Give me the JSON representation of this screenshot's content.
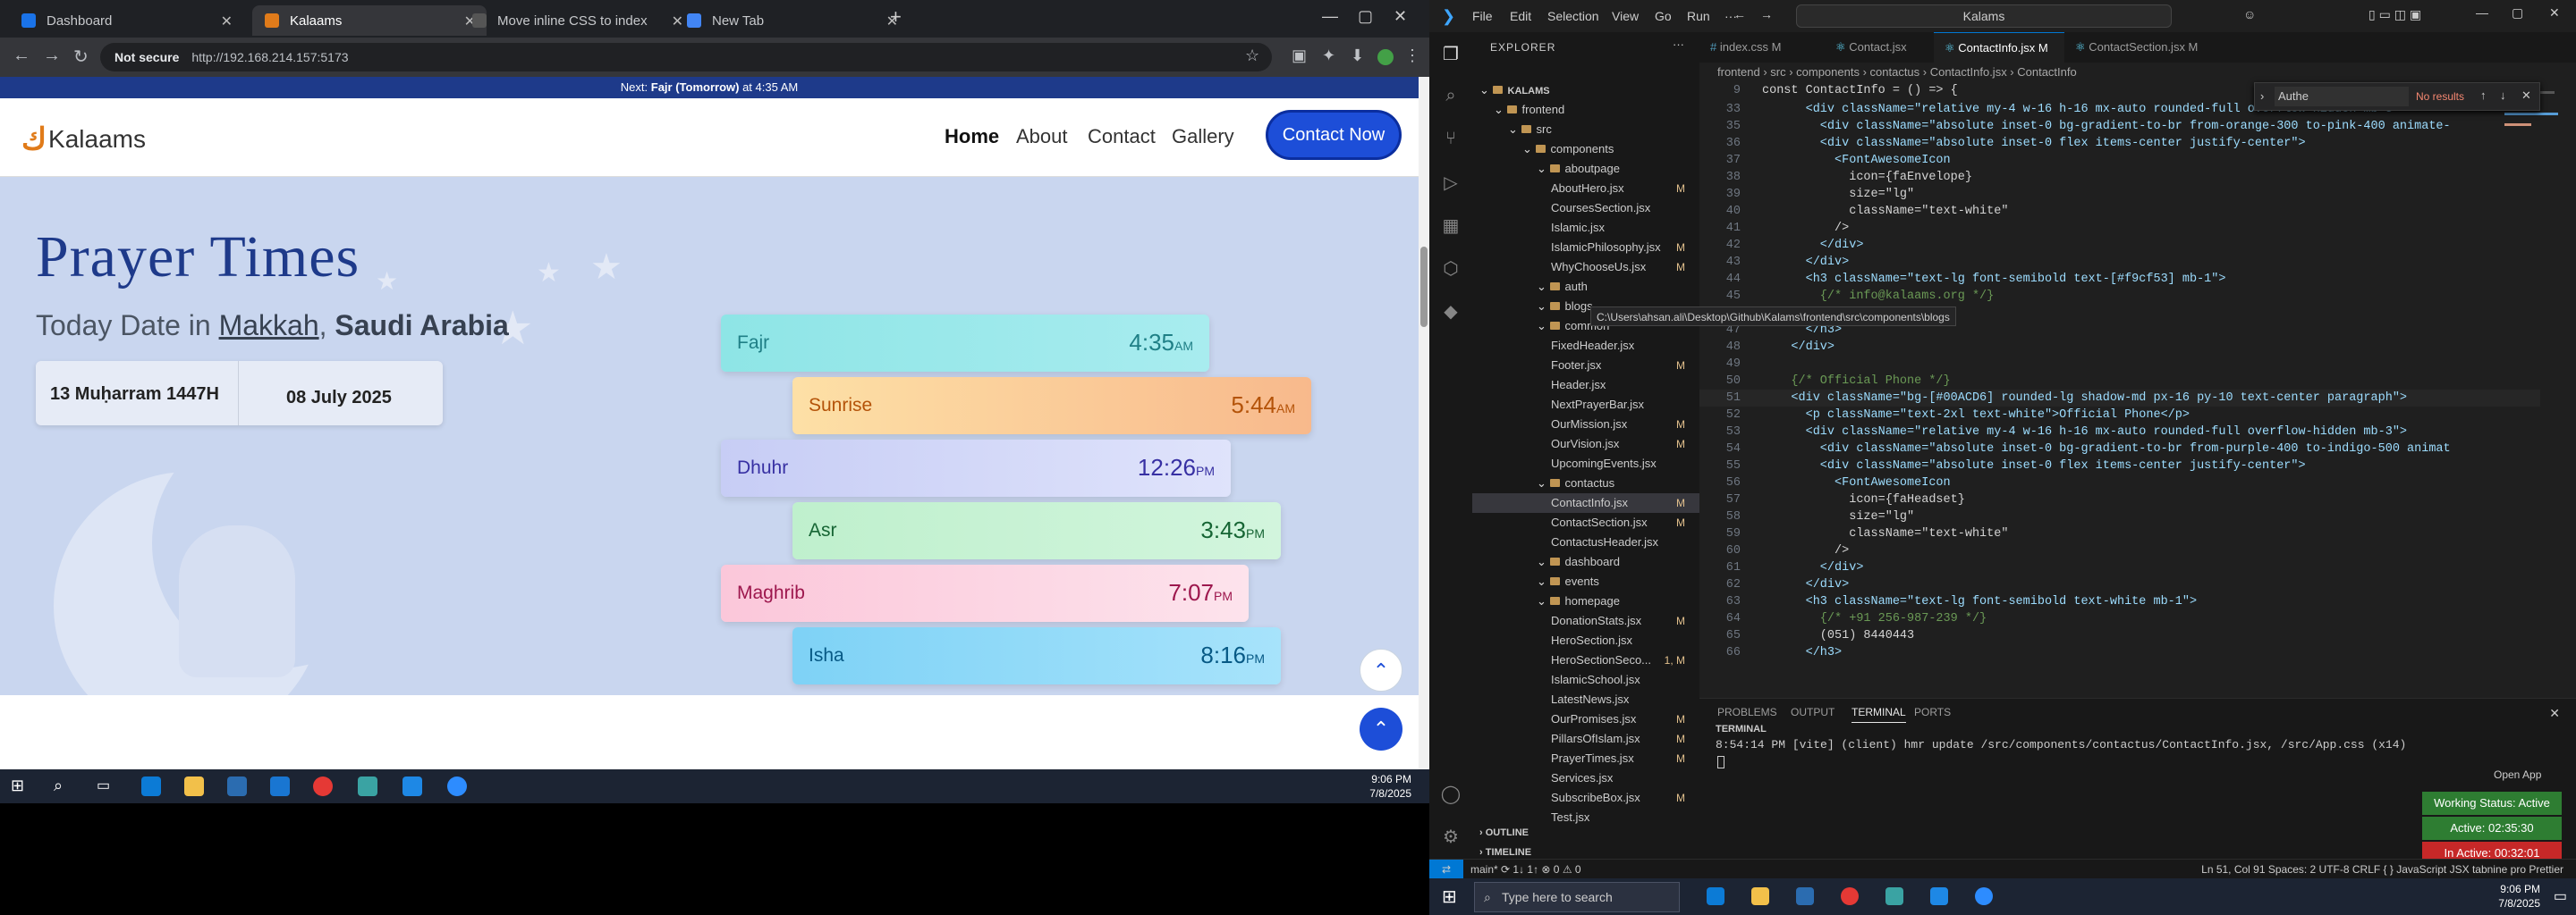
{
  "browser": {
    "tabs": [
      {
        "title": "Dashboard",
        "active": false,
        "color": "#1a73e8"
      },
      {
        "title": "Kalaams",
        "active": true,
        "color": "#e07b1a"
      },
      {
        "title": "Move inline CSS to index",
        "active": false,
        "color": "#555"
      },
      {
        "title": "New Tab",
        "active": false,
        "color": "#4285f4"
      }
    ],
    "not_secure": "Not secure",
    "url": "http://192.168.214.157:5173"
  },
  "site": {
    "notice_prefix": "Next: ",
    "notice_name": "Fajr (Tomorrow)",
    "notice_suffix": " at 4:35 AM",
    "logo_mark": "ك",
    "logo_text": "Kalaams",
    "nav": [
      "Home",
      "About",
      "Contact",
      "Gallery"
    ],
    "cta": "Contact Now",
    "title": "Prayer Times",
    "date_prefix": "Today Date in ",
    "city": "Makkah",
    "country": "Saudi Arabia",
    "hijri": "13 Muḥarram 1447H",
    "greg": "08 July 2025",
    "prayers": [
      {
        "name": "Fajr",
        "time": "4:35",
        "ampm": "AM",
        "bg": "linear-gradient(90deg,#8ee5e6,#a8ecef)",
        "fg": "#1f7f86"
      },
      {
        "name": "Sunrise",
        "time": "5:44",
        "ampm": "AM",
        "bg": "linear-gradient(90deg,#fde0a6,#f8b98c)",
        "fg": "#b45309"
      },
      {
        "name": "Dhuhr",
        "time": "12:26",
        "ampm": "PM",
        "bg": "linear-gradient(90deg,#c7cdf5,#dfe3fb)",
        "fg": "#3730a3"
      },
      {
        "name": "Asr",
        "time": "3:43",
        "ampm": "PM",
        "bg": "linear-gradient(90deg,#bff0cd,#d2f5dd)",
        "fg": "#166534"
      },
      {
        "name": "Maghrib",
        "time": "7:07",
        "ampm": "PM",
        "bg": "linear-gradient(90deg,#fbc7da,#fde3ec)",
        "fg": "#9d174d"
      },
      {
        "name": "Isha",
        "time": "8:16",
        "ampm": "PM",
        "bg": "linear-gradient(90deg,#7ed2f6,#a7e3fb)",
        "fg": "#075985"
      }
    ]
  },
  "taskbar_left": {
    "time": "9:06 PM",
    "date": "7/8/2025"
  },
  "vscode": {
    "menu": [
      "File",
      "Edit",
      "Selection",
      "View",
      "Go",
      "Run",
      "···"
    ],
    "search": "Kalams",
    "explorer_title": "EXPLORER",
    "tree": [
      {
        "label": "KALAMS",
        "indent": 0,
        "type": "root",
        "status": ""
      },
      {
        "label": "frontend",
        "indent": 1,
        "type": "folder",
        "status": ""
      },
      {
        "label": "src",
        "indent": 2,
        "type": "folder",
        "status": ""
      },
      {
        "label": "components",
        "indent": 3,
        "type": "folder",
        "status": ""
      },
      {
        "label": "aboutpage",
        "indent": 4,
        "type": "folder",
        "status": ""
      },
      {
        "label": "AboutHero.jsx",
        "indent": 5,
        "type": "file",
        "status": "M"
      },
      {
        "label": "CoursesSection.jsx",
        "indent": 5,
        "type": "file",
        "status": ""
      },
      {
        "label": "Islamic.jsx",
        "indent": 5,
        "type": "file",
        "status": ""
      },
      {
        "label": "IslamicPhilosophy.jsx",
        "indent": 5,
        "type": "file",
        "status": "M"
      },
      {
        "label": "WhyChooseUs.jsx",
        "indent": 5,
        "type": "file",
        "status": "M"
      },
      {
        "label": "auth",
        "indent": 4,
        "type": "folder",
        "status": ""
      },
      {
        "label": "blogs",
        "indent": 4,
        "type": "folder",
        "status": ""
      },
      {
        "label": "common",
        "indent": 4,
        "type": "folder",
        "status": ""
      },
      {
        "label": "FixedHeader.jsx",
        "indent": 5,
        "type": "file",
        "status": ""
      },
      {
        "label": "Footer.jsx",
        "indent": 5,
        "type": "file",
        "status": "M"
      },
      {
        "label": "Header.jsx",
        "indent": 5,
        "type": "file",
        "status": ""
      },
      {
        "label": "NextPrayerBar.jsx",
        "indent": 5,
        "type": "file",
        "status": ""
      },
      {
        "label": "OurMission.jsx",
        "indent": 5,
        "type": "file",
        "status": "M"
      },
      {
        "label": "OurVision.jsx",
        "indent": 5,
        "type": "file",
        "status": "M"
      },
      {
        "label": "UpcomingEvents.jsx",
        "indent": 5,
        "type": "file",
        "status": ""
      },
      {
        "label": "contactus",
        "indent": 4,
        "type": "folder",
        "status": ""
      },
      {
        "label": "ContactInfo.jsx",
        "indent": 5,
        "type": "file",
        "status": "M",
        "sel": true
      },
      {
        "label": "ContactSection.jsx",
        "indent": 5,
        "type": "file",
        "status": "M"
      },
      {
        "label": "ContactusHeader.jsx",
        "indent": 5,
        "type": "file",
        "status": ""
      },
      {
        "label": "dashboard",
        "indent": 4,
        "type": "folder",
        "status": ""
      },
      {
        "label": "events",
        "indent": 4,
        "type": "folder",
        "status": ""
      },
      {
        "label": "homepage",
        "indent": 4,
        "type": "folder",
        "status": ""
      },
      {
        "label": "DonationStats.jsx",
        "indent": 5,
        "type": "file",
        "status": "M"
      },
      {
        "label": "HeroSection.jsx",
        "indent": 5,
        "type": "file",
        "status": ""
      },
      {
        "label": "HeroSectionSeco...",
        "indent": 5,
        "type": "file",
        "status": "1, M"
      },
      {
        "label": "IslamicSchool.jsx",
        "indent": 5,
        "type": "file",
        "status": ""
      },
      {
        "label": "LatestNews.jsx",
        "indent": 5,
        "type": "file",
        "status": ""
      },
      {
        "label": "OurPromises.jsx",
        "indent": 5,
        "type": "file",
        "status": "M"
      },
      {
        "label": "PillarsOfIslam.jsx",
        "indent": 5,
        "type": "file",
        "status": "M"
      },
      {
        "label": "PrayerTimes.jsx",
        "indent": 5,
        "type": "file",
        "status": "M"
      },
      {
        "label": "Services.jsx",
        "indent": 5,
        "type": "file",
        "status": ""
      },
      {
        "label": "SubscribeBox.jsx",
        "indent": 5,
        "type": "file",
        "status": "M"
      },
      {
        "label": "Test.jsx",
        "indent": 5,
        "type": "file",
        "status": ""
      }
    ],
    "tooltip": "C:\\Users\\ahsan.ali\\Desktop\\Github\\Kalams\\frontend\\src\\components\\blogs",
    "outline": "OUTLINE",
    "timeline": "TIMELINE",
    "tabs": [
      "index.css M",
      "Contact.jsx",
      "ContactInfo.jsx M",
      "ContactSection.jsx M"
    ],
    "breadcrumb": "frontend › src › components › contactus › ContactInfo.jsx › ContactInfo",
    "find": {
      "value": "Authe",
      "result": "No results"
    },
    "code": [
      {
        "n": "9",
        "t": "const ContactInfo = () => {"
      },
      {
        "n": "33",
        "t": "      <div className=\"relative my-4 w-16 h-16 mx-auto rounded-full overflow-hidden mb-3\">"
      },
      {
        "n": "35",
        "t": "        <div className=\"absolute inset-0 bg-gradient-to-br from-orange-300 to-pink-400 animate-"
      },
      {
        "n": "36",
        "t": "        <div className=\"absolute inset-0 flex items-center justify-center\">"
      },
      {
        "n": "37",
        "t": "          <FontAwesomeIcon"
      },
      {
        "n": "38",
        "t": "            icon={faEnvelope}"
      },
      {
        "n": "39",
        "t": "            size=\"lg\""
      },
      {
        "n": "40",
        "t": "            className=\"text-white\""
      },
      {
        "n": "41",
        "t": "          />"
      },
      {
        "n": "42",
        "t": "        </div>"
      },
      {
        "n": "43",
        "t": "      </div>"
      },
      {
        "n": "44",
        "t": "      <h3 className=\"text-lg font-semibold text-[#f9cf53] mb-1\">"
      },
      {
        "n": "45",
        "t": "        {/* info@kalaams.org */}"
      },
      {
        "n": "46",
        "t": "        info@kalaams.org"
      },
      {
        "n": "47",
        "t": "      </h3>"
      },
      {
        "n": "48",
        "t": "    </div>"
      },
      {
        "n": "49",
        "t": ""
      },
      {
        "n": "50",
        "t": "    {/* Official Phone */}"
      },
      {
        "n": "51",
        "t": "    <div className=\"bg-[#00ACD6] rounded-lg shadow-md px-16 py-10 text-center paragraph\">"
      },
      {
        "n": "52",
        "t": "      <p className=\"text-2xl text-white\">Official Phone</p>"
      },
      {
        "n": "53",
        "t": "      <div className=\"relative my-4 w-16 h-16 mx-auto rounded-full overflow-hidden mb-3\">"
      },
      {
        "n": "54",
        "t": "        <div className=\"absolute inset-0 bg-gradient-to-br from-purple-400 to-indigo-500 animat"
      },
      {
        "n": "55",
        "t": "        <div className=\"absolute inset-0 flex items-center justify-center\">"
      },
      {
        "n": "56",
        "t": "          <FontAwesomeIcon"
      },
      {
        "n": "57",
        "t": "            icon={faHeadset}"
      },
      {
        "n": "58",
        "t": "            size=\"lg\""
      },
      {
        "n": "59",
        "t": "            className=\"text-white\""
      },
      {
        "n": "60",
        "t": "          />"
      },
      {
        "n": "61",
        "t": "        </div>"
      },
      {
        "n": "62",
        "t": "      </div>"
      },
      {
        "n": "63",
        "t": "      <h3 className=\"text-lg font-semibold text-white mb-1\">"
      },
      {
        "n": "64",
        "t": "        {/* +91 256-987-239 */}"
      },
      {
        "n": "65",
        "t": "        (051) 8440443"
      },
      {
        "n": "66",
        "t": "      </h3>"
      }
    ],
    "panel_tabs": [
      "PROBLEMS",
      "OUTPUT",
      "TERMINAL",
      "PORTS"
    ],
    "terminal_title": "TERMINAL",
    "terminal_line": "8:54:14 PM [vite] (client) hmr update /src/components/contactus/ContactInfo.jsx, /src/App.css (x14)",
    "open_app": "Open App",
    "working": "Working Status: Active",
    "active": "Active: 02:35:30",
    "inactive": "In Active: 00:32:01",
    "status_left": "main*  ⟳ 1↓ 1↑   ⊗ 0 ⚠ 0",
    "status_right": "Ln 51, Col 91   Spaces: 2   UTF-8   CRLF   { } JavaScript JSX   tabnine pro   Prettier",
    "search_placeholder": "Type here to search",
    "time": "9:06 PM",
    "date": "7/8/2025"
  }
}
